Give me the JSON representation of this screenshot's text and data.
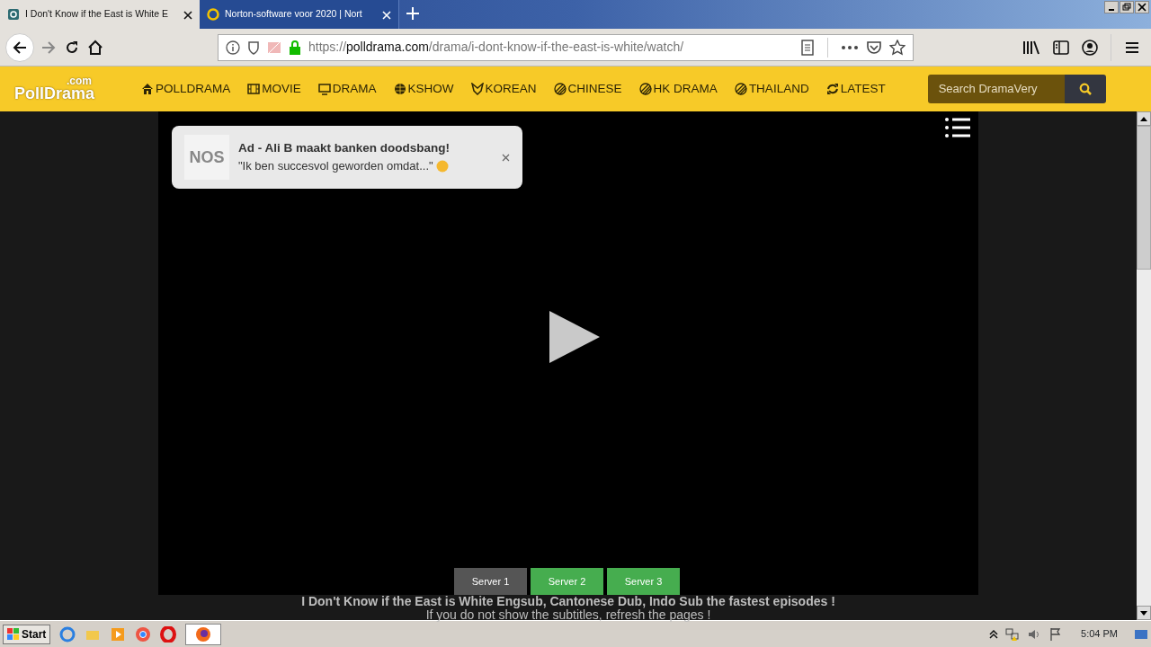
{
  "browser": {
    "tabs": [
      {
        "title": "I Don't Know if the East is White E",
        "selected": true
      },
      {
        "title": "Norton-software voor 2020 | Nort",
        "selected": false
      }
    ],
    "url": {
      "scheme": "https://",
      "host": "polldrama.com",
      "path": "/drama/i-dont-know-if-the-east-is-white/watch/"
    }
  },
  "site": {
    "logo": "PollDrama",
    "logo_suffix": ".com",
    "nav": [
      {
        "label": "POLLDRAMA"
      },
      {
        "label": "MOVIE"
      },
      {
        "label": "DRAMA"
      },
      {
        "label": "KSHOW"
      },
      {
        "label": "KOREAN"
      },
      {
        "label": "CHINESE"
      },
      {
        "label": "HK DRAMA"
      },
      {
        "label": "THAILAND"
      },
      {
        "label": "LATEST"
      }
    ],
    "search": {
      "placeholder": "Search DramaVery"
    }
  },
  "ad": {
    "brand": "NOS",
    "title": "Ad - Ali B maakt banken doodsbang!",
    "text": "\"Ik ben succesvol geworden omdat...\""
  },
  "servers": [
    {
      "label": "Server 1",
      "selected": true
    },
    {
      "label": "Server 2",
      "selected": false
    },
    {
      "label": "Server 3",
      "selected": false
    }
  ],
  "captions": [
    "I Don't Know if the East is White Engsub, Cantonese Dub, Indo Sub the fastest episodes !",
    "If you do not show the subtitles, refresh the pages !"
  ],
  "taskbar": {
    "start": "Start",
    "clock": "5:04 PM"
  }
}
